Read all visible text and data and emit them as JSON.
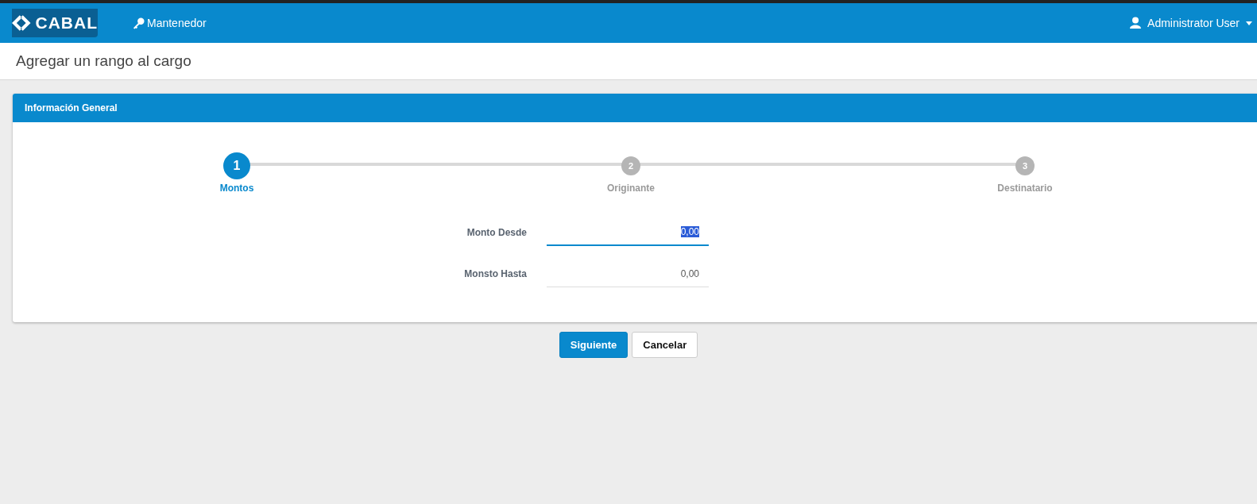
{
  "navbar": {
    "logo": "CABAL",
    "menu": [
      {
        "label": "Mantenedor"
      }
    ],
    "user": "Administrator User"
  },
  "page_title": "Agregar un rango al cargo",
  "panel": {
    "title": "Información General",
    "steps": [
      {
        "number": "1",
        "label": "Montos",
        "selected": true
      },
      {
        "number": "2",
        "label": "Originante",
        "selected": false
      },
      {
        "number": "3",
        "label": "Destinatario",
        "selected": false
      }
    ],
    "fields": [
      {
        "label": "Monto Desde",
        "value": "0,00",
        "focused": true
      },
      {
        "label": "Monsto Hasta",
        "value": "0,00",
        "focused": false
      }
    ]
  },
  "buttons": [
    {
      "label": "Siguiente",
      "kind": "primary"
    },
    {
      "label": "Cancelar",
      "kind": "default"
    }
  ]
}
